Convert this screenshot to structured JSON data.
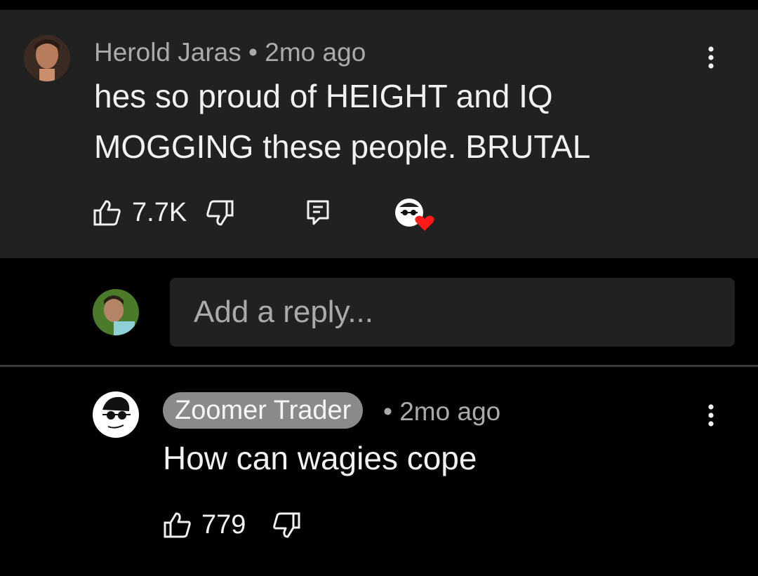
{
  "comment": {
    "author": "Herold Jaras",
    "time": "• 2mo ago",
    "text_line1": "hes so proud of HEIGHT and IQ",
    "text_line2": "MOGGING these people. BRUTAL",
    "likes": "7.7K",
    "icons": [
      "thumbs-up-icon",
      "thumbs-down-icon",
      "reply-icon",
      "creator-heart-icon",
      "more-vert-icon"
    ]
  },
  "reply_box": {
    "placeholder": "Add a reply..."
  },
  "reply": {
    "author": "Zoomer Trader",
    "time": "• 2mo ago",
    "text": "How can wagies cope",
    "likes": "779"
  },
  "colors": {
    "card_bg": "#212121",
    "page_bg": "#000000",
    "heart": "#ff1a1a",
    "chip_bg": "#8a8a8a"
  }
}
